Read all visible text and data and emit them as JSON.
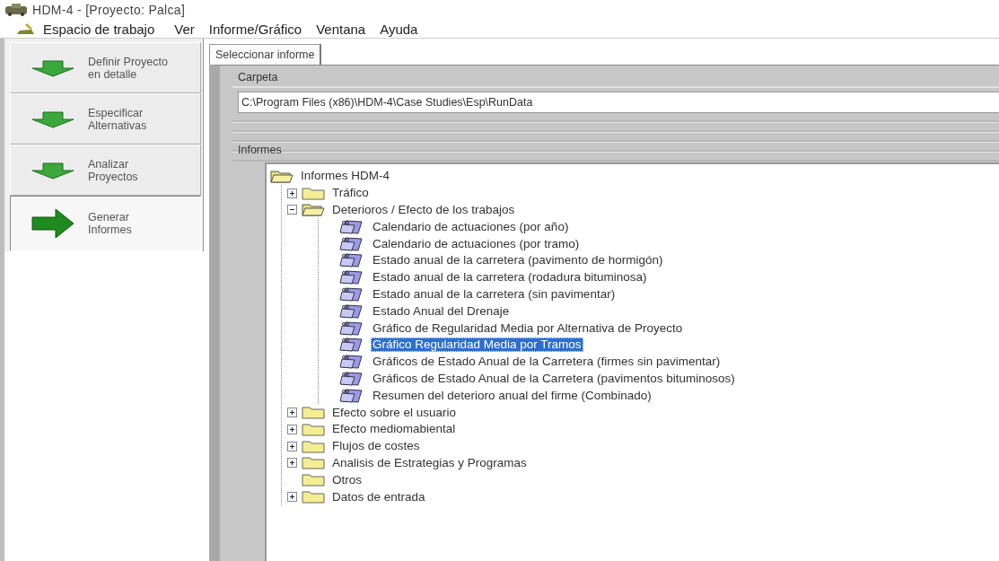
{
  "window": {
    "title": "HDM-4 - [Proyecto: Palca]"
  },
  "menu": [
    "Espacio de trabajo",
    "Ver",
    "Informe/Gráfico",
    "Ventana",
    "Ayuda"
  ],
  "sidebar": {
    "items": [
      {
        "label": "Definir Proyecto en detalle",
        "selected": false
      },
      {
        "label": "Especificar Alternativas",
        "selected": false
      },
      {
        "label": "Analizar Proyectos",
        "selected": false
      },
      {
        "label": "Generar Informes",
        "selected": true
      }
    ]
  },
  "tabs": [
    {
      "label": "Seleccionar informe",
      "selected": true
    }
  ],
  "folder": {
    "label": "Carpeta",
    "value": "C:\\Program Files (x86)\\HDM-4\\Case Studies\\Esp\\RunData"
  },
  "reports": {
    "label": "Informes",
    "tree": [
      {
        "label": "Informes HDM-4",
        "kind": "root",
        "expanded": true,
        "selected": false,
        "children": [
          {
            "label": "Tráfico",
            "kind": "folder",
            "expanded": false,
            "selected": false
          },
          {
            "label": "Deterioros / Efecto de los trabajos",
            "kind": "folder",
            "expanded": true,
            "selected": false,
            "children": [
              {
                "label": "Calendario de actuaciones (por año)",
                "kind": "report",
                "selected": false
              },
              {
                "label": "Calendario de actuaciones (por tramo)",
                "kind": "report",
                "selected": false
              },
              {
                "label": "Estado anual de la carretera (pavimento de hormigón)",
                "kind": "report",
                "selected": false
              },
              {
                "label": "Estado anual de la carretera (rodadura bituminosa)",
                "kind": "report",
                "selected": false
              },
              {
                "label": "Estado anual de la carretera (sin pavimentar)",
                "kind": "report",
                "selected": false
              },
              {
                "label": "Estado Anual del Drenaje",
                "kind": "report",
                "selected": false
              },
              {
                "label": "Gráfico de Regularidad Media por Alternativa de Proyecto",
                "kind": "report",
                "selected": false
              },
              {
                "label": "Gráfico Regularidad Media por Tramos",
                "kind": "report",
                "selected": true
              },
              {
                "label": "Gráficos de Estado Anual de la Carretera (firmes sin pavimentar)",
                "kind": "report",
                "selected": false
              },
              {
                "label": "Gráficos de Estado Anual de la Carretera (pavimentos bituminosos)",
                "kind": "report",
                "selected": false
              },
              {
                "label": "Resumen del deterioro anual del firme (Combinado)",
                "kind": "report",
                "selected": false
              }
            ]
          },
          {
            "label": "Efecto sobre el usuario",
            "kind": "folder",
            "expanded": false,
            "selected": false
          },
          {
            "label": "Efecto mediomabiental",
            "kind": "folder",
            "expanded": false,
            "selected": false
          },
          {
            "label": "Flujos de costes",
            "kind": "folder",
            "expanded": false,
            "selected": false
          },
          {
            "label": "Analisis de Estrategias y Programas",
            "kind": "folder",
            "expanded": false,
            "selected": false
          },
          {
            "label": "Otros",
            "kind": "empty-folder",
            "selected": false
          },
          {
            "label": "Datos de entrada",
            "kind": "folder",
            "expanded": false,
            "selected": false
          }
        ]
      }
    ]
  }
}
